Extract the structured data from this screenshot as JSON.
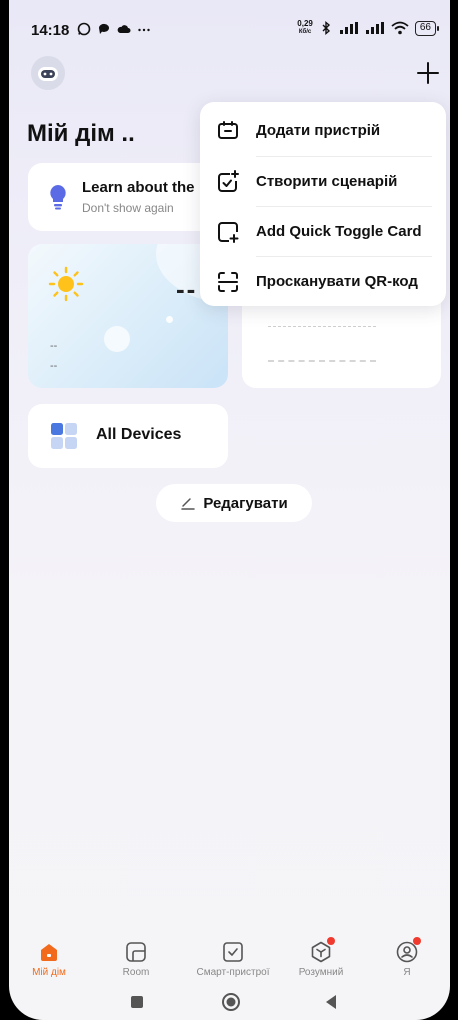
{
  "status_bar": {
    "time": "14:18",
    "net_speed_value": "0,29",
    "net_speed_unit": "Кб/с",
    "battery": "66"
  },
  "header": {
    "title": "Мій дім .."
  },
  "tip_card": {
    "title": "Learn about the",
    "subtitle": "Don't show again"
  },
  "weather_card": {
    "temperature": "--",
    "line1": "--",
    "line2": "--"
  },
  "devices_card": {
    "label": "All Devices"
  },
  "edit_button": {
    "label": "Редагувати"
  },
  "menu": {
    "items": [
      {
        "label": "Додати пристрій",
        "icon": "add-device-icon"
      },
      {
        "label": "Створити сценарій",
        "icon": "create-scene-icon"
      },
      {
        "label": "Add Quick Toggle Card",
        "icon": "quick-toggle-icon"
      },
      {
        "label": "Просканувати QR-код",
        "icon": "qr-scan-icon"
      }
    ]
  },
  "bottom_nav": {
    "items": [
      {
        "label": "Мій дім",
        "icon": "home-icon",
        "active": true
      },
      {
        "label": "Room",
        "icon": "room-icon",
        "active": false
      },
      {
        "label": "Смарт-пристрої",
        "icon": "smart-devices-icon",
        "active": false
      },
      {
        "label": "Розумний",
        "icon": "smart-scene-icon",
        "active": false
      },
      {
        "label": "Я",
        "icon": "profile-icon",
        "active": false
      }
    ]
  },
  "colors": {
    "accent": "#f26a1b",
    "badge": "#f03a2e",
    "tip_bulb": "#5b6be6"
  }
}
